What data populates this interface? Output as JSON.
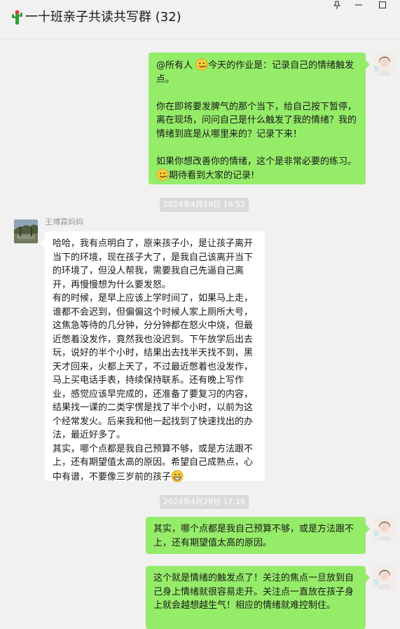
{
  "window": {
    "title": "一十班亲子共读共写群 (32)",
    "pin_glyph": "⊥",
    "minimize_glyph": "—",
    "maximize_glyph": "□"
  },
  "colors": {
    "self_bubble": "#95ec69",
    "other_bubble": "#ffffff",
    "background": "#f1f1f1"
  },
  "messages": {
    "m1": {
      "line1a": "@所有人 ",
      "line1b": "今天的作业是：记录自己的情绪触发点。",
      "para2": "你在即将要发脾气的那个当下，给自己按下暂停，离在现场，问问自己是什么触发了我的情绪？我的情绪到底是从哪里来的？记录下来！",
      "para3a": "如果你想改善你的情绪，这个是非常必要的练习。",
      "para3b": "期待看到大家的记录!"
    },
    "ts1": "2024年4月29日 16:52",
    "m2": {
      "sender": "王博霖妈妈",
      "text": "哈哈，我有点明白了，原来孩子小，是让孩子离开当下的环境，现在孩子大了，是我自己该离开当下的环境了，但没人帮我，需要我自己先逼自己离开，再慢慢想为什么要发怒。\n有的时候，是早上应该上学时间了，如果马上走，谁都不会迟到，但偏偏这个时候人家上厕所大号，这焦急等待的几分钟，分分钟都在怒火中烧，但最近憋着没发作，竟然我也没迟到。下午放学后出去玩，说好的半个小时，结果出去找半天找不到，黑天才回来，火都上天了，不过最近憋着也没发作，马上买电话手表，持续保持联系。还有晚上写作业，感觉应该早完成的，还准备了要复习的内容，结果找一课的二类字愣是找了半个小时，以前为这个经常发火。后来我和他一起找到了快速找出的办法，最近好多了。\n其实，哪个点都是我自己预算不够，或是方法跟不上，还有期望值太高的原因。希望自己成熟点，心中有谱，不要像三岁前的孩子"
    },
    "ts2": "2024年4月29日 17:16",
    "m3": {
      "text": "其实，哪个点都是我自己预算不够，或是方法跟不上，还有期望值太高的原因。"
    },
    "m4": {
      "text": "这个就是情绪的触发点了！关注的焦点一旦放到自己身上情绪就很容易走开。关注点一直放在孩子身上就会越想越生气！相应的情绪就难控制住。"
    }
  }
}
